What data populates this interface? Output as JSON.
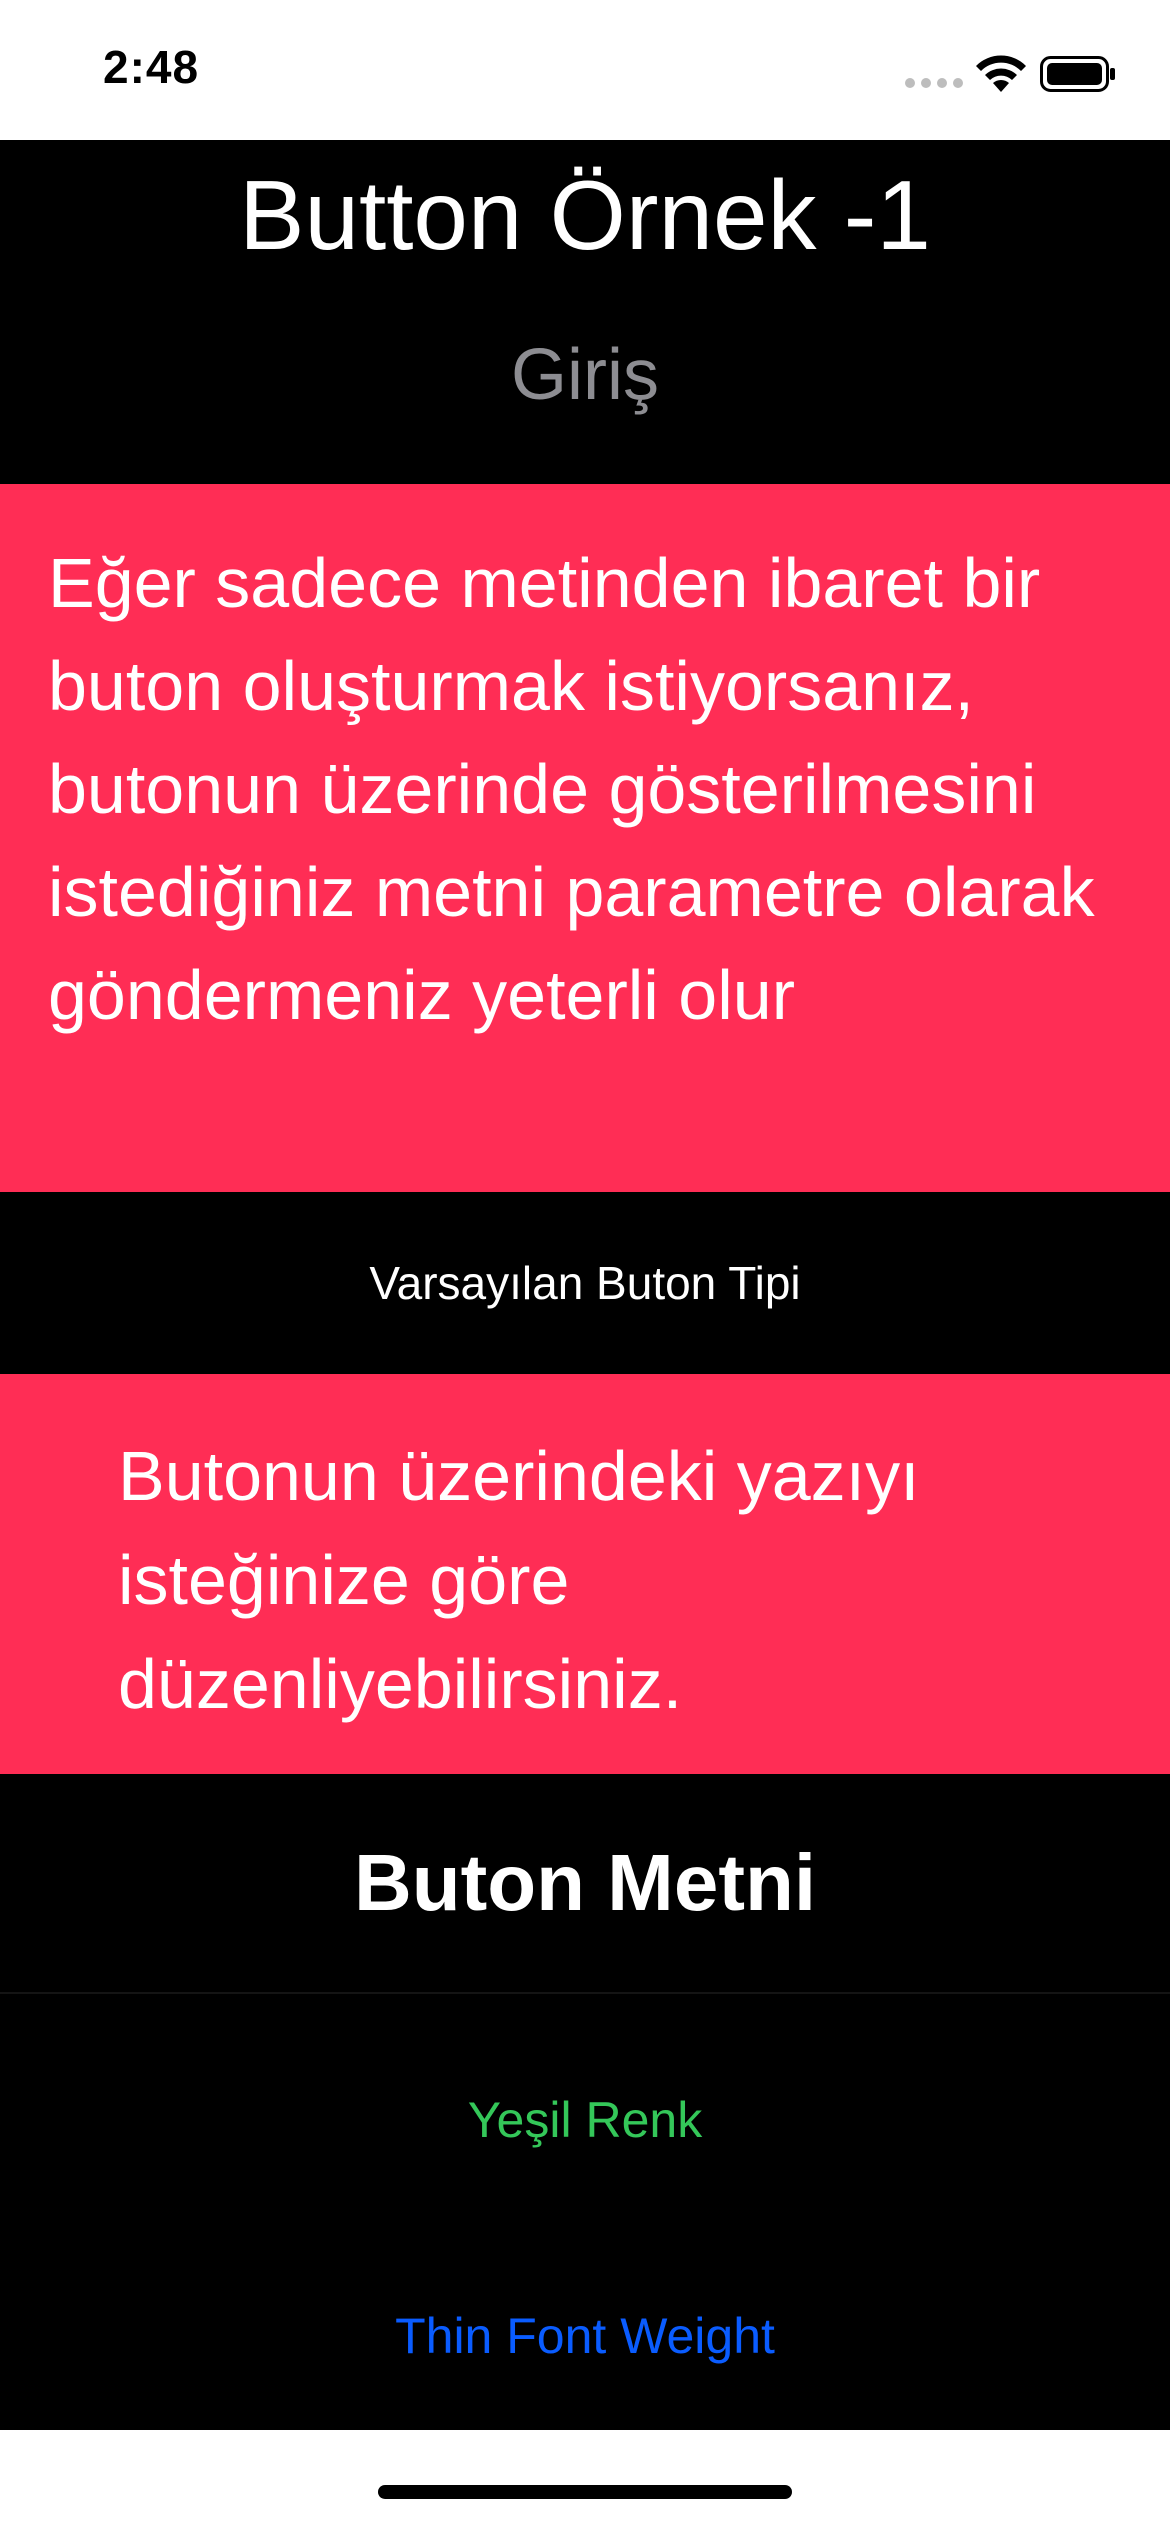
{
  "status_bar": {
    "time": "2:48",
    "icons": [
      "signal-dots-icon",
      "wifi-icon",
      "battery-icon"
    ]
  },
  "content": {
    "title": "Button Örnek -1",
    "subtitle": "Giriş",
    "description1": "Eğer sadece metinden ibaret bir buton oluşturmak istiyorsanız, butonun üzerinde gösterilmesini istediğiniz metni parametre olarak göndermeniz yeterli olur",
    "default_button_label": "Varsayılan Buton Tipi",
    "description2": "Butonun üzerindeki yazıyı isteğinize göre düzenliyebilirsiniz.",
    "bold_button_label": "Buton Metni",
    "green_button_label": "Yeşil Renk",
    "thin_button_label": "Thin Font Weight"
  },
  "colors": {
    "accent_red": "#ff2d55",
    "green": "#34c759",
    "blue": "#0a5cff",
    "gray_text": "#8d8d92",
    "background": "#000000"
  }
}
